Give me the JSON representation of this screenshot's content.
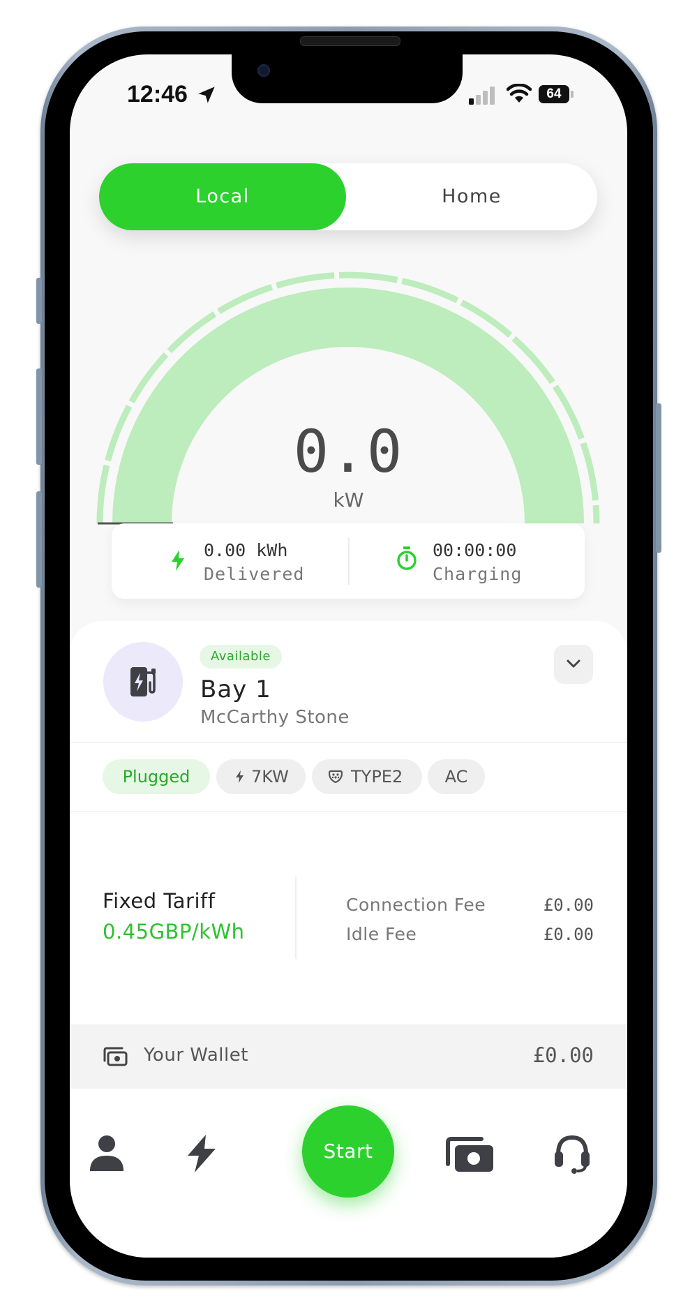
{
  "status_bar": {
    "time": "12:46",
    "battery": "64"
  },
  "toggle": {
    "options": [
      "Local",
      "Home"
    ],
    "active": "Local"
  },
  "gauge": {
    "value": "0.0",
    "unit": "kW",
    "level": 0.0
  },
  "stats": {
    "energy": {
      "value": "0.00 kWh",
      "label": "Delivered"
    },
    "time": {
      "value": "00:00:00",
      "label": "Charging"
    }
  },
  "bay": {
    "status": "Available",
    "name": "Bay 1",
    "location": "McCarthy Stone"
  },
  "chips": {
    "plug_state": "Plugged",
    "power": "7KW",
    "connector": "TYPE2",
    "current": "AC"
  },
  "tariff": {
    "label": "Fixed Tariff",
    "rate": "0.45GBP/kWh",
    "fees": [
      {
        "label": "Connection Fee",
        "value": "£0.00"
      },
      {
        "label": "Idle Fee",
        "value": "£0.00"
      }
    ]
  },
  "wallet": {
    "label": "Your Wallet",
    "amount": "£0.00"
  },
  "nav": {
    "start_label": "Start",
    "icons": [
      "user-icon",
      "bolt-icon",
      "wallet-icon",
      "headset-icon"
    ]
  },
  "colors": {
    "accent": "#2cd12e",
    "gauge_fill": "#bdecbd",
    "avatar_bg": "#ece9fb",
    "badge_bg": "#e6f7e6"
  }
}
